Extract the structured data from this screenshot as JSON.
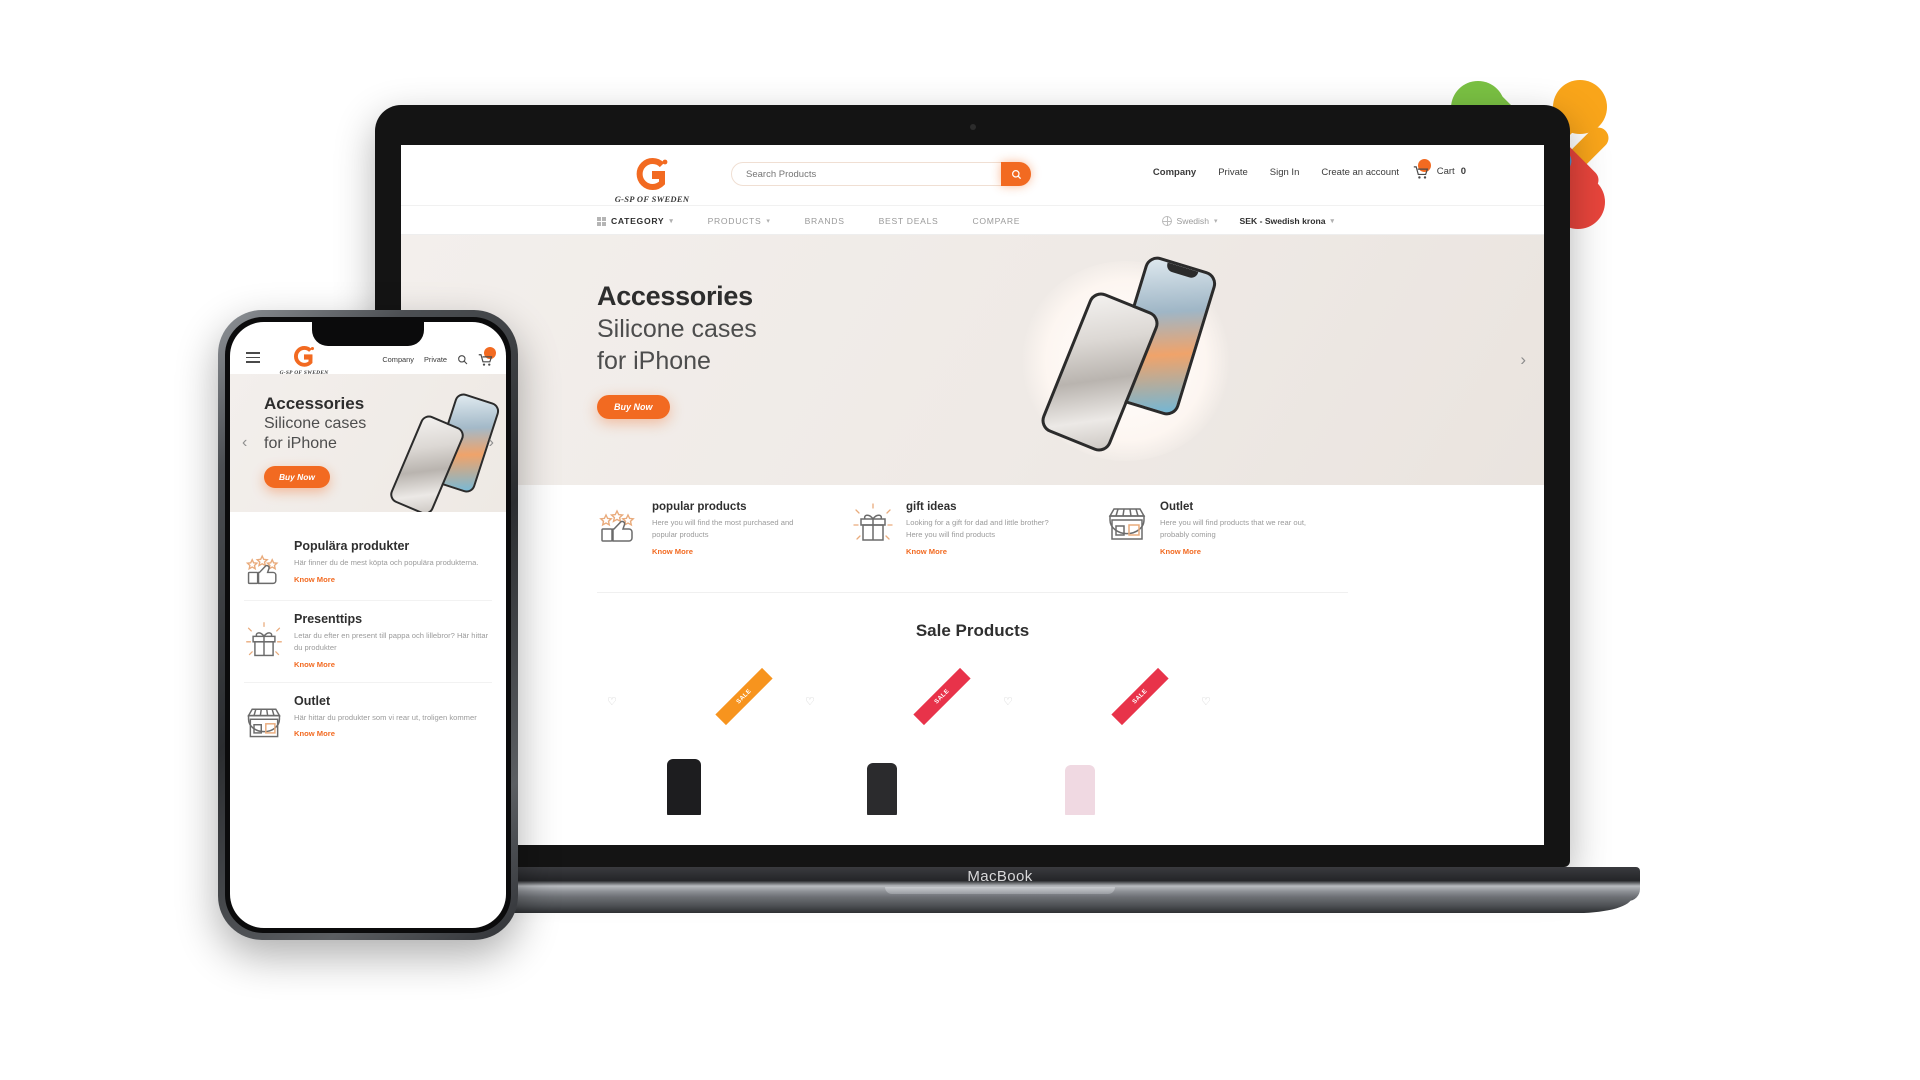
{
  "scene": {
    "laptop_label": "MacBook",
    "brand_accent": "#f26a21",
    "joomla_colors": {
      "green": "#7ac143",
      "orange": "#f9a51a",
      "red": "#e8453c",
      "blue": "#5091cd"
    }
  },
  "site": {
    "logo": {
      "mark": "g-sp-monogram",
      "name": "G-SP OF SWEDEN"
    },
    "search": {
      "placeholder": "Search Products",
      "value": "",
      "icon": "search-icon"
    },
    "top_nav": [
      {
        "label": "Company",
        "bold": true
      },
      {
        "label": "Private",
        "bold": false
      },
      {
        "label": "Sign In",
        "bold": false
      },
      {
        "label": "Create an account",
        "bold": false
      }
    ],
    "cart": {
      "icon": "cart-icon",
      "label": "Cart",
      "count": "0"
    },
    "menu": [
      {
        "label": "CATEGORY",
        "caret": true,
        "grid_icon": "grid-icon"
      },
      {
        "label": "PRODUCTS",
        "caret": true
      },
      {
        "label": "BRANDS",
        "caret": false
      },
      {
        "label": "BEST DEALS",
        "caret": false
      },
      {
        "label": "COMPARE",
        "caret": false
      }
    ],
    "locale": {
      "language": "Swedish",
      "currency": "SEK - Swedish krona"
    },
    "hero": {
      "title": "Accessories",
      "line2": "Silicone cases",
      "line3": "for iPhone",
      "cta": "Buy Now",
      "next_arrow": "›"
    },
    "features": [
      {
        "icon": "thumbs-up-stars-icon",
        "title": "popular products",
        "desc": "Here you will find the most purchased and popular products",
        "link": "Know More"
      },
      {
        "icon": "gift-box-icon",
        "title": "gift ideas",
        "desc": "Looking for a gift for dad and little brother? Here you will find products",
        "link": "Know More"
      },
      {
        "icon": "storefront-icon",
        "title": "Outlet",
        "desc": "Here you will find products that we rear out, probably coming",
        "link": "Know More"
      }
    ],
    "sale": {
      "heading": "Sale Products",
      "products": [
        {
          "heart": "♡",
          "ribbon": "SALE",
          "ribbon_color": "#f7941e"
        },
        {
          "heart": "♡",
          "ribbon": "SALE",
          "ribbon_color": "#e8334a"
        },
        {
          "heart": "♡",
          "ribbon": "SALE",
          "ribbon_color": "#e8334a"
        },
        {
          "heart": "♡",
          "ribbon": "",
          "ribbon_color": ""
        }
      ]
    }
  },
  "mobile": {
    "menu_icon": "hamburger-icon",
    "logo": {
      "mark": "g-sp-monogram",
      "name": "G-SP OF SWEDEN"
    },
    "nav": [
      {
        "label": "Company"
      },
      {
        "label": "Private"
      }
    ],
    "search_icon": "search-icon",
    "cart": {
      "icon": "cart-icon",
      "count": "0"
    },
    "hero": {
      "title": "Accessories",
      "line2": "Silicone cases",
      "line3": "for iPhone",
      "cta": "Buy Now",
      "prev_arrow": "‹",
      "next_arrow": "›"
    },
    "features": [
      {
        "icon": "thumbs-up-stars-icon",
        "title": "Populära produkter",
        "desc": "Här finner du de mest köpta och populära produkterna.",
        "link": "Know More"
      },
      {
        "icon": "gift-box-icon",
        "title": "Presenttips",
        "desc": "Letar du efter en present till pappa och lillebror? Här hittar du produkter",
        "link": "Know More"
      },
      {
        "icon": "storefront-icon",
        "title": "Outlet",
        "desc": "Här hittar du produkter som vi rear ut, troligen kommer",
        "link": "Know More"
      }
    ]
  }
}
